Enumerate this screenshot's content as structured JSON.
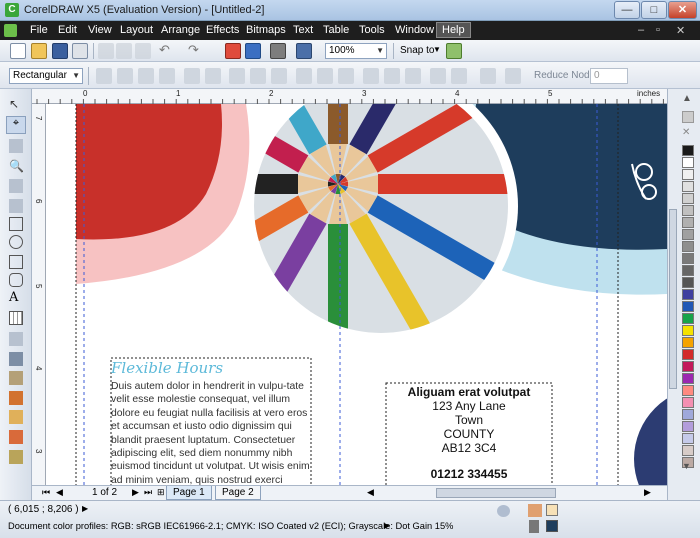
{
  "window": {
    "title": "CorelDRAW X5 (Evaluation Version) - [Untitled-2]",
    "minimize": "—",
    "maximize": "□",
    "close": "✕"
  },
  "menu": [
    "File",
    "Edit",
    "View",
    "Layout",
    "Arrange",
    "Effects",
    "Bitmaps",
    "Text",
    "Table",
    "Tools",
    "Window",
    "Help"
  ],
  "toolbar": {
    "zoom": "100%",
    "snap_to": "Snap to"
  },
  "property_bar": {
    "shape": "Rectangular",
    "reduce_nodes": "Reduce Nodes",
    "nodes_value": "0"
  },
  "ruler": {
    "units": "inches",
    "h_ticks": [
      "0",
      "1",
      "2",
      "3",
      "4",
      "5",
      "6",
      "7"
    ],
    "v_ticks": [
      "7",
      "6",
      "5",
      "4",
      "3",
      "2"
    ],
    "v_units": "inches"
  },
  "canvas": {
    "flex_title": "Flexible Hours",
    "lorem": "Duis autem dolor in hendrerit in vulpu-tate velit esse molestie consequat, vel illum dolore eu feugiat nulla facilisis at vero eros et accumsan et iusto odio dignissim qui blandit praesent luptatum. Consectetuer adipiscing elit, sed diem nonummy nibh euismod tincidunt ut volutpat. Ut wisis enim ad minim veniam, quis nostrud exerci",
    "address": {
      "heading": "Aliguam erat volutpat",
      "line1": "123 Any Lane",
      "line2": "Town",
      "line3": "COUNTY",
      "line4": "AB12 3C4",
      "phone": "01212 334455"
    }
  },
  "pages": {
    "counter": "1 of 2",
    "tabs": [
      "Page 1",
      "Page 2"
    ]
  },
  "status": {
    "coords": "( 6,015 ; 8,206 )",
    "profiles": "Document color profiles: RGB: sRGB IEC61966-2.1; CMYK: ISO Coated v2 (ECI); Grayscale: Dot Gain 15%"
  },
  "colors": {
    "palette": [
      "#1a1a1a",
      "#ffffff",
      "#f0f0f0",
      "#e0e0e0",
      "#d0d0d0",
      "#c0c0c0",
      "#b0b0b0",
      "#a0a0a0",
      "#8e8e8e",
      "#7a7a7a",
      "#666666",
      "#555555",
      "#3f3f9f",
      "#1f57b5",
      "#17a34a",
      "#f5e100",
      "#f5a300",
      "#d22a2a",
      "#c2185b",
      "#9c27b0",
      "#ff8a80",
      "#f48fb1",
      "#9fa8da",
      "#b39ddb",
      "#c5cae9",
      "#d7ccc8",
      "#bcaaa4"
    ],
    "accent_red": "#c8302a",
    "accent_navy": "#1e3d5c",
    "accent_blue": "#5cb9d9"
  }
}
